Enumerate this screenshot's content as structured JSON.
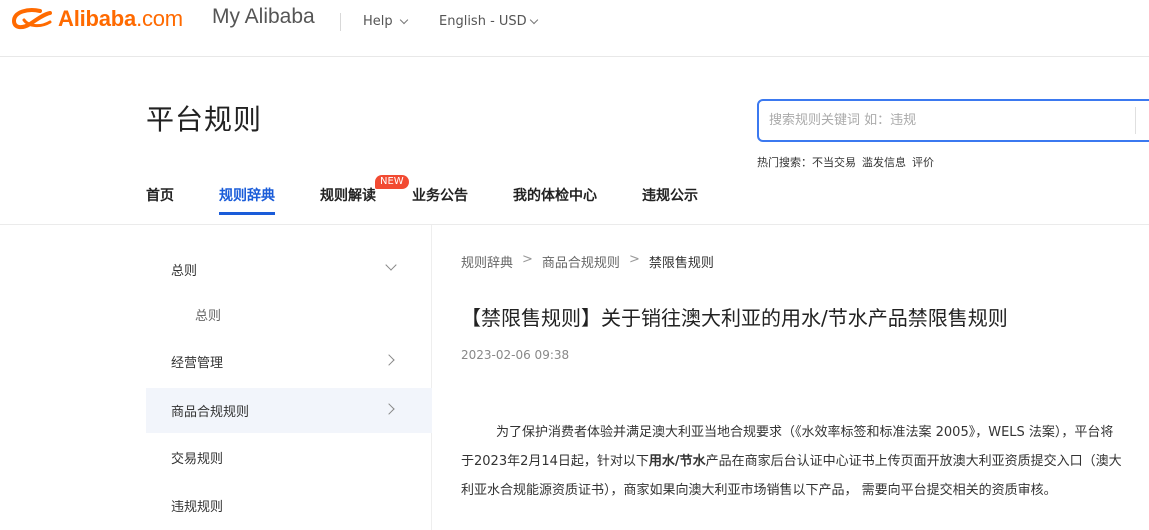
{
  "colors": {
    "brand": "#ff6a00",
    "accent": "#1a5cd9",
    "badge": "#f24a32",
    "search_border": "#3b79f0"
  },
  "topbar": {
    "logo_name": "Alibaba",
    "logo_suffix": ".com",
    "product": "My Alibaba",
    "help": "Help",
    "language": "English - USD"
  },
  "header": {
    "title": "平台规则",
    "search_placeholder": "搜索规则关键词 如：违规",
    "hot_label": "热门搜索：",
    "hot_terms": [
      "不当交易",
      "滥发信息",
      "评价"
    ]
  },
  "nav": {
    "items": [
      "首页",
      "规则辞典",
      "规则解读",
      "业务公告",
      "我的体检中心",
      "违规公示"
    ],
    "badge": "NEW"
  },
  "sidebar": {
    "items": [
      "总则",
      "总则",
      "经营管理",
      "商品合规规则",
      "交易规则",
      "违规规则"
    ]
  },
  "breadcrumb": {
    "items": [
      "规则辞典",
      "商品合规规则",
      "禁限售规则"
    ],
    "separator": ">"
  },
  "article": {
    "title": "【禁限售规则】关于销往澳大利亚的用水/节水产品禁限售规则",
    "date": "2023-02-06 09:38",
    "body_part1": "为了保护消费者体验并满足澳大利亚当地合规要求（《水效率标签和标准法案 2005》，WELS 法案），平台将于2023年2月14日起，针对以下",
    "body_bold": "用水/节水",
    "body_part2": "产品在商家后台认证中心证书上传页面开放澳大利亚资质提交入口（澳大利亚水合规能源资质证书），商家如果向澳大利亚市场销售以下产品，  需要向平台提交相关的资质审核。"
  }
}
